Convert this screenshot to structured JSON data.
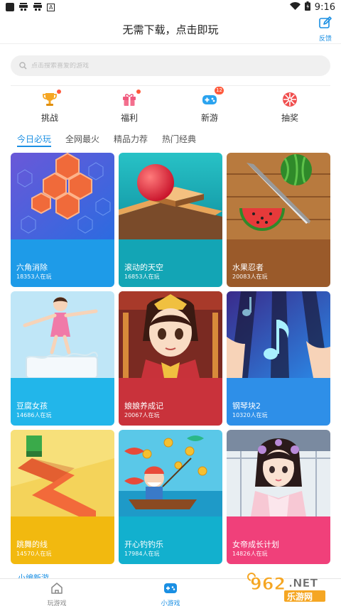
{
  "status_bar": {
    "time": "9:16",
    "notif_letter": "A"
  },
  "header": {
    "title": "无需下载，点击即玩",
    "feedback_label": "反馈"
  },
  "search": {
    "placeholder": "点击搜索喜爱的游戏"
  },
  "quick_nav": [
    {
      "label": "挑战",
      "icon": "trophy-icon",
      "indicator": "dot"
    },
    {
      "label": "福利",
      "icon": "gift-icon",
      "indicator": "dot"
    },
    {
      "label": "新游",
      "icon": "gamepad-icon",
      "badge": "12"
    },
    {
      "label": "抽奖",
      "icon": "lottery-wheel-icon"
    }
  ],
  "tabs": [
    {
      "label": "今日必玩",
      "active": true
    },
    {
      "label": "全网最火",
      "active": false
    },
    {
      "label": "精品力荐",
      "active": false
    },
    {
      "label": "热门经典",
      "active": false
    }
  ],
  "games": [
    {
      "name": "六角消除",
      "players": "18353人在玩",
      "color": "#1e9be8"
    },
    {
      "name": "滚动的天空",
      "players": "16853人在玩",
      "color": "#13a5b5"
    },
    {
      "name": "水果忍者",
      "players": "20083人在玩",
      "color": "#9a5a2a"
    },
    {
      "name": "豆腐女孩",
      "players": "14686人在玩",
      "color": "#22b6ea"
    },
    {
      "name": "娘娘养成记",
      "players": "20067人在玩",
      "color": "#c9323b"
    },
    {
      "name": "钢琴块2",
      "players": "10320人在玩",
      "color": "#2e8fe8"
    },
    {
      "name": "跳舞的线",
      "players": "14570人在玩",
      "color": "#f2b90f"
    },
    {
      "name": "开心钓钓乐",
      "players": "17984人在玩",
      "color": "#12b0ce"
    },
    {
      "name": "女帝成长计划",
      "players": "14826人在玩",
      "color": "#f0407a"
    }
  ],
  "section_peek": "小编新游",
  "bottom_nav": [
    {
      "label": "玩游戏",
      "icon": "home-icon",
      "active": false
    },
    {
      "label": "小游戏",
      "icon": "gamepad-icon",
      "active": true
    }
  ],
  "watermark": {
    "text": "962.NET",
    "subtext": "乐游网"
  }
}
